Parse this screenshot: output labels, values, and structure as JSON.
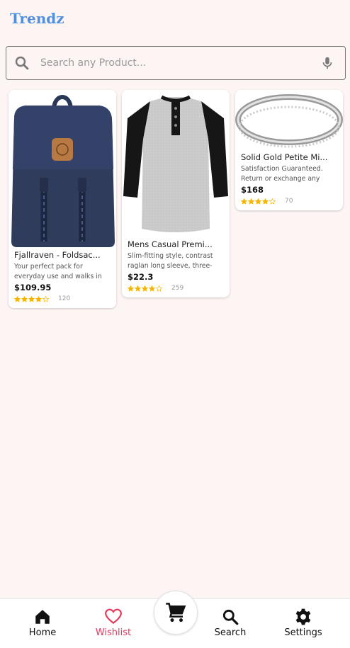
{
  "app": {
    "title": "Trendz"
  },
  "search": {
    "placeholder": "Search any Product..."
  },
  "products": [
    {
      "name": "Fjallraven - Foldsac...",
      "description": "Your perfect pack for everyday use and walks in",
      "price": "$109.95",
      "rating": 3.9,
      "count": "120",
      "image": "backpack"
    },
    {
      "name": "Mens Casual Premi...",
      "description": "Slim-fitting style, contrast raglan long sleeve, three-",
      "price": "$22.3",
      "rating": 4.1,
      "count": "259",
      "image": "henley-shirt"
    },
    {
      "name": "Solid Gold Petite Mi...",
      "description": "Satisfaction Guaranteed. Return or exchange any",
      "price": "$168",
      "rating": 3.9,
      "count": "70",
      "image": "silver-ring"
    }
  ],
  "nav": {
    "home": "Home",
    "wishlist": "Wishlist",
    "search": "Search",
    "settings": "Settings"
  },
  "colors": {
    "accent": "#4f8fe0",
    "active": "#e5395b",
    "star": "#f4b400",
    "background": "#fdf4f4"
  }
}
